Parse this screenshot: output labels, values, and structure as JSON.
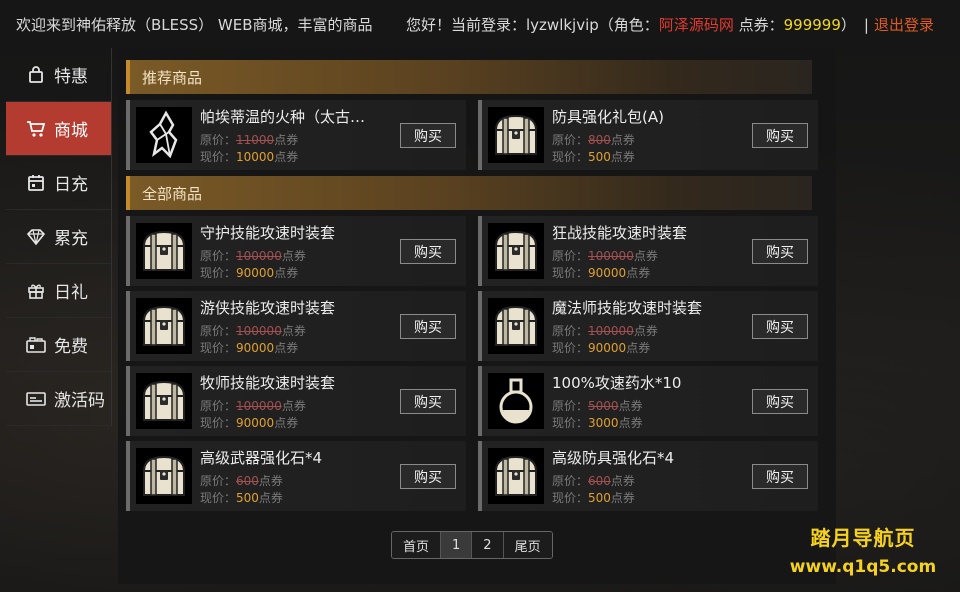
{
  "topbar": {
    "marquee": "欢迎来到神佑释放（BLESS） WEB商城，丰富的商品",
    "greeting": "您好！当前登录：",
    "username": "lyzwlkjvip",
    "role_prefix": "（角色：",
    "role": "阿泽源码网",
    "points_prefix": " 点券：",
    "points": "999999",
    "role_suffix": "）",
    "separator": "|",
    "logout": "退出登录"
  },
  "sidebar": {
    "items": [
      {
        "label": "特惠",
        "icon": "bag-icon"
      },
      {
        "label": "商城",
        "icon": "cart-icon"
      },
      {
        "label": "日充",
        "icon": "calendar-icon"
      },
      {
        "label": "累充",
        "icon": "diamond-icon"
      },
      {
        "label": "日礼",
        "icon": "gift-icon"
      },
      {
        "label": "免费",
        "icon": "free-icon"
      },
      {
        "label": "激活码",
        "icon": "card-icon"
      }
    ],
    "active_index": 1
  },
  "sections": {
    "recommended": "推荐商品",
    "all": "全部商品"
  },
  "labels": {
    "original": "原价：",
    "current": "现价：",
    "unit": "点券",
    "buy": "购买"
  },
  "recommended": [
    {
      "name": "帕埃蒂温的火种（太古…",
      "original": "11000",
      "current": "10000",
      "icon": "crystal-icon"
    },
    {
      "name": "防具强化礼包(A)",
      "original": "800",
      "current": "500",
      "icon": "chest-icon"
    }
  ],
  "products": [
    {
      "name": "守护技能攻速时装套",
      "original": "100000",
      "current": "90000",
      "icon": "chest-icon"
    },
    {
      "name": "狂战技能攻速时装套",
      "original": "100000",
      "current": "90000",
      "icon": "chest-icon"
    },
    {
      "name": "游侠技能攻速时装套",
      "original": "100000",
      "current": "90000",
      "icon": "chest-icon"
    },
    {
      "name": "魔法师技能攻速时装套",
      "original": "100000",
      "current": "90000",
      "icon": "chest-icon"
    },
    {
      "name": "牧师技能攻速时装套",
      "original": "100000",
      "current": "90000",
      "icon": "chest-icon"
    },
    {
      "name": "100%攻速药水*10",
      "original": "5000",
      "current": "3000",
      "icon": "potion-icon"
    },
    {
      "name": "高级武器强化石*4",
      "original": "600",
      "current": "500",
      "icon": "chest-icon"
    },
    {
      "name": "高级防具强化石*4",
      "original": "600",
      "current": "500",
      "icon": "chest-icon"
    }
  ],
  "pager": {
    "first": "首页",
    "pages": [
      "1",
      "2"
    ],
    "current": "1",
    "last": "尾页"
  },
  "watermark": {
    "line1": "踏月导航页",
    "line2": "www.q1q5.com"
  },
  "colors": {
    "accent_red": "#b33b2f",
    "gold": "#e0a030",
    "points_yellow": "#f2d81e",
    "role_red": "#e03a2e"
  }
}
